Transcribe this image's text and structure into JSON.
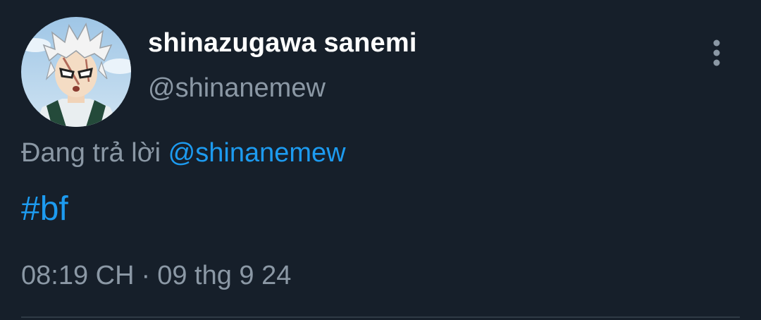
{
  "tweet": {
    "author": {
      "display_name": "shinazugawa sanemi",
      "handle": "@shinanemew"
    },
    "reply_to": {
      "prefix": "Đang trả lời ",
      "mention": "@shinanemew"
    },
    "text": "#bf",
    "time": "08:19 CH",
    "separator": "·",
    "date": "09 thg 9 24"
  },
  "icons": {
    "more": "more-vertical-icon",
    "avatar": "avatar-image"
  },
  "colors": {
    "background": "#161f2a",
    "text_primary": "#ffffff",
    "text_secondary": "#8b98a5",
    "accent": "#1d9bf0",
    "divider": "#2f3a45"
  }
}
